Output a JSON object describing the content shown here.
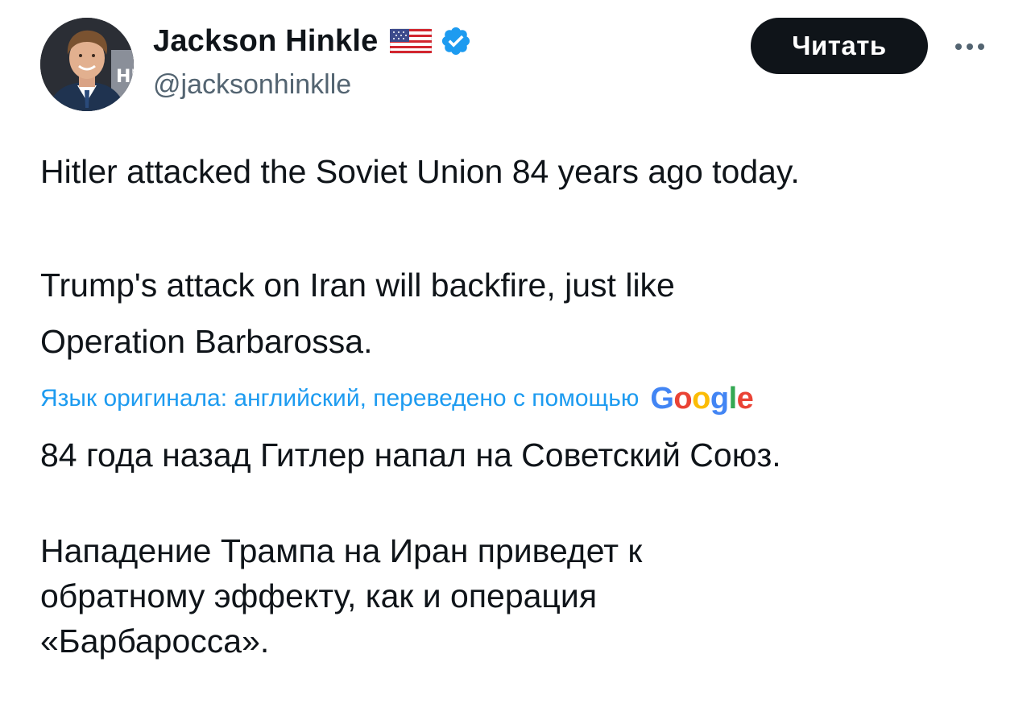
{
  "author": {
    "display_name": "Jackson Hinkle",
    "handle": "@jacksonhinklle",
    "flag_icon": "us-flag-icon",
    "verified_icon": "verified-badge-icon",
    "verified_color": "#1d9bf0"
  },
  "actions": {
    "read_label": "Читать",
    "more_icon": "more-dots-icon"
  },
  "tweet": {
    "original_lines": [
      "Hitler attacked the Soviet Union 84 years ago today.",
      "Trump's attack on Iran will backfire, just like",
      "Operation Barbarossa."
    ],
    "translation_note": "Язык оригинала: английский, переведено с помощью",
    "translation_provider": "Google",
    "translated_lines": [
      "84 года назад Гитлер напал на Советский Союз.",
      "Нападение Трампа на Иран приведет к",
      "обратному эффекту, как и операция",
      "«Барбаросса»."
    ]
  },
  "colors": {
    "text_primary": "#0f1419",
    "text_secondary": "#536471",
    "link_blue": "#1d9bf0",
    "button_bg": "#0f1419"
  }
}
